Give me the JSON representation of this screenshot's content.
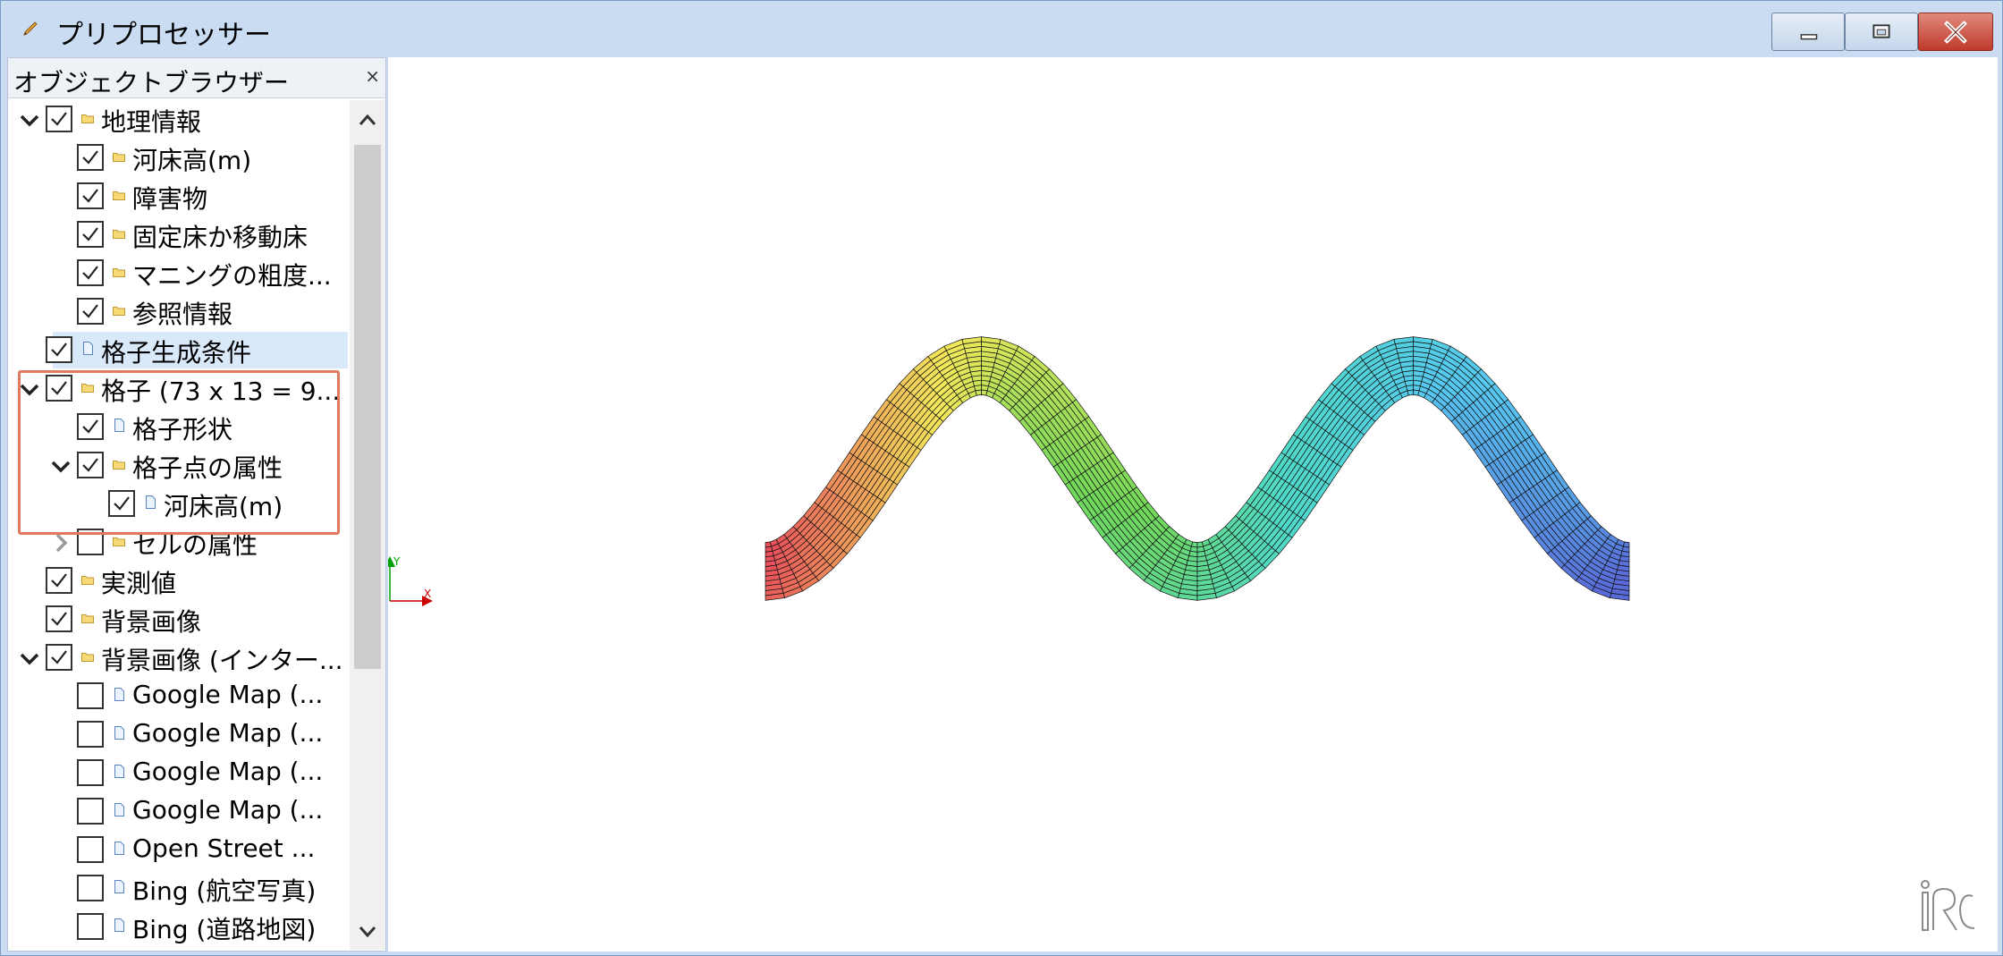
{
  "window": {
    "title": "プリプロセッサー",
    "buttons": [
      "minimize-icon",
      "maximize-icon",
      "close-icon"
    ]
  },
  "object_browser": {
    "title": "オブジェクトブラウザー",
    "close_glyph": "×",
    "items": [
      {
        "label": "地理情報",
        "level": 0,
        "expander": "down",
        "checked": true,
        "icon": "folder-icon"
      },
      {
        "label": "河床高(m)",
        "level": 1,
        "expander": "none",
        "checked": true,
        "icon": "folder-icon"
      },
      {
        "label": "障害物",
        "level": 1,
        "expander": "none",
        "checked": true,
        "icon": "folder-icon"
      },
      {
        "label": "固定床か移動床",
        "level": 1,
        "expander": "none",
        "checked": true,
        "icon": "folder-icon"
      },
      {
        "label": "マニングの粗度...",
        "level": 1,
        "expander": "none",
        "checked": true,
        "icon": "folder-icon"
      },
      {
        "label": "参照情報",
        "level": 1,
        "expander": "none",
        "checked": true,
        "icon": "folder-icon"
      },
      {
        "label": "格子生成条件",
        "level": 0,
        "expander": "none",
        "checked": true,
        "icon": "document-icon",
        "selected": true
      },
      {
        "label": "格子 (73 x 13 = 9...",
        "level": 0,
        "expander": "down",
        "checked": true,
        "icon": "folder-icon"
      },
      {
        "label": "格子形状",
        "level": 1,
        "expander": "none",
        "checked": true,
        "icon": "document-icon"
      },
      {
        "label": "格子点の属性",
        "level": 1,
        "expander": "down",
        "checked": true,
        "icon": "folder-icon"
      },
      {
        "label": "河床高(m)",
        "level": 2,
        "expander": "none",
        "checked": true,
        "icon": "document-icon"
      },
      {
        "label": "セルの属性",
        "level": 1,
        "expander": "right",
        "checked": false,
        "icon": "folder-icon"
      },
      {
        "label": "実測値",
        "level": 0,
        "expander": "none",
        "checked": true,
        "icon": "folder-icon"
      },
      {
        "label": "背景画像",
        "level": 0,
        "expander": "none",
        "checked": true,
        "icon": "folder-icon"
      },
      {
        "label": "背景画像 (インター...",
        "level": 0,
        "expander": "down",
        "checked": true,
        "icon": "folder-icon"
      },
      {
        "label": "Google Map (...",
        "level": 1,
        "expander": "none",
        "checked": false,
        "icon": "document-icon"
      },
      {
        "label": "Google Map (...",
        "level": 1,
        "expander": "none",
        "checked": false,
        "icon": "document-icon"
      },
      {
        "label": "Google Map (...",
        "level": 1,
        "expander": "none",
        "checked": false,
        "icon": "document-icon"
      },
      {
        "label": "Google Map (...",
        "level": 1,
        "expander": "none",
        "checked": false,
        "icon": "document-icon"
      },
      {
        "label": "Open Street ...",
        "level": 1,
        "expander": "none",
        "checked": false,
        "icon": "document-icon"
      },
      {
        "label": "Bing (航空写真)",
        "level": 1,
        "expander": "none",
        "checked": false,
        "icon": "document-icon"
      },
      {
        "label": "Bing (道路地図)",
        "level": 1,
        "expander": "none",
        "checked": false,
        "icon": "document-icon"
      }
    ]
  },
  "viewport": {
    "axis": {
      "x_label": "X",
      "y_label": "Y",
      "x_color": "#cc0000",
      "y_color": "#00a000"
    },
    "logo": "iRIC-logo-icon",
    "grid": {
      "colormap": [
        "#e8505b",
        "#f3e85a",
        "#72d85a",
        "#4fd9c8",
        "#56c8f0",
        "#5a6ad8"
      ]
    }
  },
  "colors": {
    "titlebar": "#c9dcf1",
    "selection": "#d9e9f9",
    "highlight_box": "#e07a5f"
  }
}
